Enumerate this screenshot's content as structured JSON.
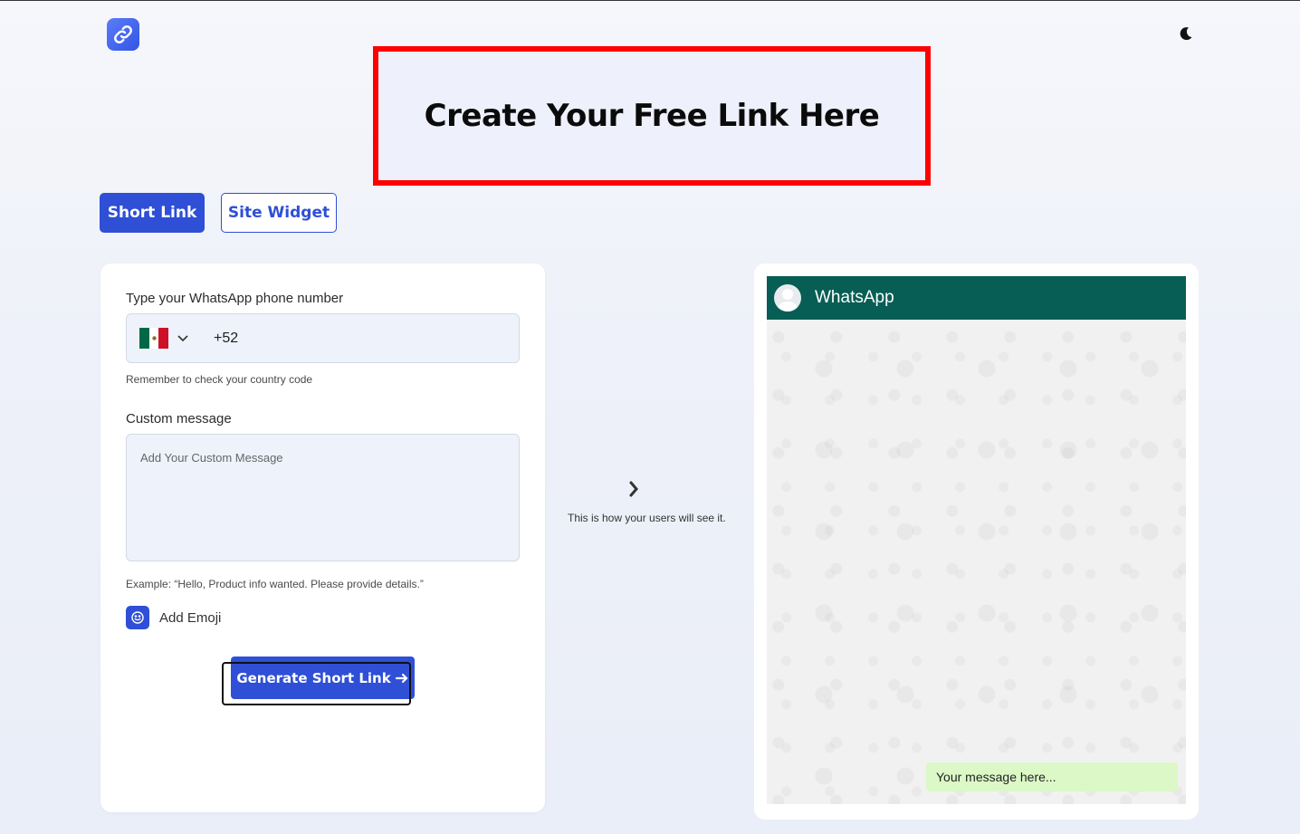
{
  "hero": {
    "title": "Create Your Free Link Here"
  },
  "tabs": [
    {
      "label": "Short Link"
    },
    {
      "label": "Site Widget"
    }
  ],
  "form": {
    "phone_label": "Type your WhatsApp phone number",
    "country_code": "+52",
    "country_flag": "mexico-flag-icon",
    "phone_hint": "Remember to check your country code",
    "message_label": "Custom message",
    "message_placeholder": "Add Your Custom Message",
    "message_example": "Example: “Hello, Product info wanted. Please provide details.”",
    "emoji_label": "Add Emoji",
    "generate_label": "Generate Short Link"
  },
  "middle": {
    "caption": "This is how your users will see it."
  },
  "preview": {
    "header_title": "WhatsApp",
    "bubble_text": "Your message here..."
  },
  "colors": {
    "primary": "#2e4fd6",
    "whatsapp_header": "#075e54",
    "bubble": "#dcf8c6",
    "highlight_border": "#ff0000"
  }
}
